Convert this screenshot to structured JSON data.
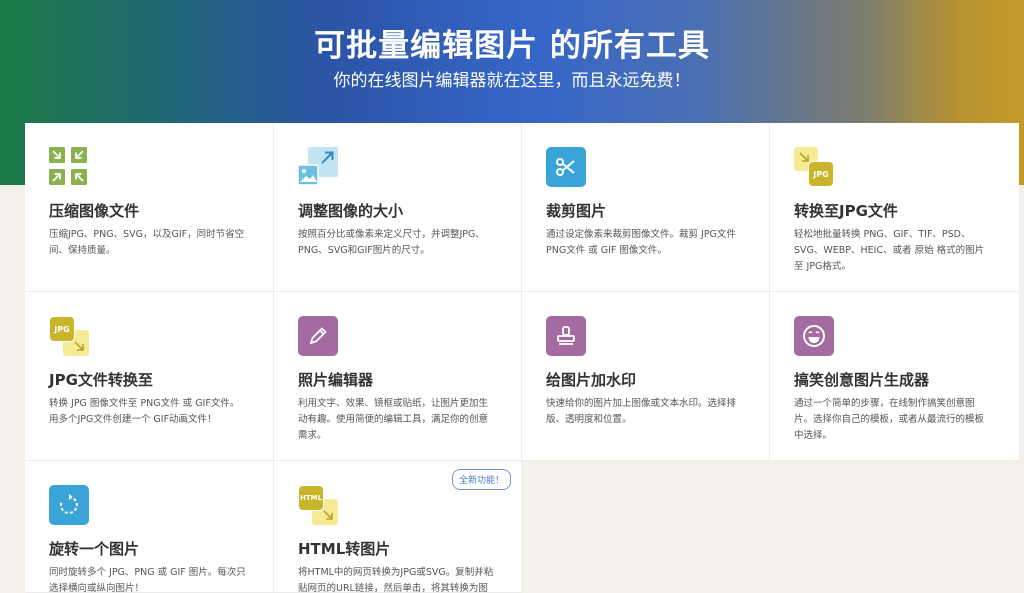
{
  "hero": {
    "title": "可批量编辑图片 的所有工具",
    "subtitle": "你的在线图片编辑器就在这里，而且永远免费！"
  },
  "colors": {
    "compress": "#8cb04e",
    "resize": "#6bbfe0",
    "crop": "#3aa4d8",
    "jpg_yellow": "#c9b52a",
    "jpg_light": "#f7ea95",
    "purple": "#a46ba0",
    "rotate": "#3aa4d8"
  },
  "tools": [
    {
      "icon": "compress-icon",
      "title": "压缩图像文件",
      "desc": "压缩JPG、PNG、SVG，以及GIF，同时节省空间、保持质量。"
    },
    {
      "icon": "resize-icon",
      "title": "调整图像的大小",
      "desc": "按照百分比或像素来定义尺寸，并调整JPG、PNG、SVG和GIF图片的尺寸。"
    },
    {
      "icon": "scissors-icon",
      "title": "裁剪图片",
      "desc": "通过设定像素来裁剪图像文件。裁剪 JPG文件 PNG文件 或 GIF 图像文件。"
    },
    {
      "icon": "jpg-convert-icon",
      "label": "JPG",
      "title": "转换至JPG文件",
      "desc": "轻松地批量转换 PNG、GIF、TIF、PSD、SVG、WEBP、HEIC、或者 原始 格式的图片至 JPG格式。"
    },
    {
      "icon": "jpg-from-icon",
      "label": "JPG",
      "title": "JPG文件转换至",
      "desc": "转换 JPG 图像文件至 PNG文件 或 GIF文件。用多个JPG文件创建一个 GIF动画文件！"
    },
    {
      "icon": "pencil-icon",
      "title": "照片编辑器",
      "desc": "利用文字、效果、镜框或贴纸，让图片更加生动有趣。使用简便的编辑工具，满足你的创意需求。"
    },
    {
      "icon": "stamp-icon",
      "title": "给图片加水印",
      "desc": "快速给你的图片加上图像或文本水印。选择排版、透明度和位置。"
    },
    {
      "icon": "meme-face-icon",
      "title": "搞笑创意图片生成器",
      "desc": "通过一个简单的步骤，在线制作搞笑创意图片。选择你自己的模板，或者从最流行的模板中选择。"
    },
    {
      "icon": "rotate-icon",
      "title": "旋转一个图片",
      "desc": "同时旋转多个 JPG、PNG 或 GIF 图片。每次只选择横向或纵向图片！"
    },
    {
      "icon": "html-convert-icon",
      "label": "HTML",
      "title": "HTML转图片",
      "desc": "将HTML中的网页转换为JPG或SVG。复制并粘贴网页的URL链接，然后单击，将其转换为图",
      "badge": "全新功能！"
    }
  ]
}
